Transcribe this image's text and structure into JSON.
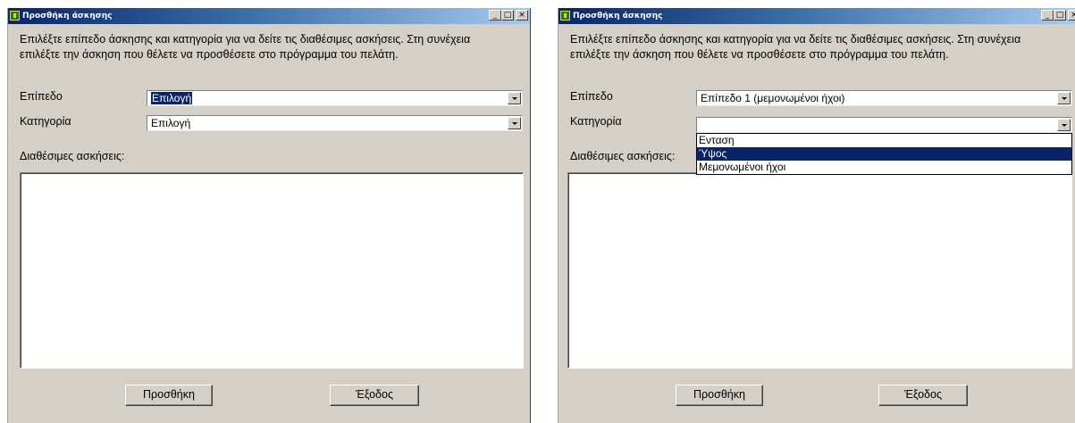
{
  "windows": [
    {
      "title": "Προσθήκη άσκησης",
      "titlebar_buttons": {
        "minimize": "_",
        "maximize": "□",
        "close": "×"
      },
      "instructions": "Επιλέξτε επίπεδο άσκησης και κατηγορία για να δείτε τις διαθέσιμες ασκήσεις. Στη συνέχεια\nεπιλέξτε την άσκηση που θέλετε να προσθέσετε στο πρόγραμμα του πελάτη.",
      "level_label": "Επίπεδο",
      "level_value": "Επιλογή",
      "category_label": "Κατηγορία",
      "category_value": "Επιλογή",
      "available_label": "Διαθέσιμες ασκήσεις:",
      "add_button": "Προσθήκη",
      "exit_button": "Έξοδος"
    },
    {
      "title": "Προσθήκη άσκησης",
      "titlebar_buttons": {
        "minimize": "_",
        "maximize": "□",
        "close": "×"
      },
      "instructions": "Επιλέξτε επίπεδο άσκησης και κατηγορία για να δείτε τις διαθέσιμες ασκήσεις. Στη συνέχεια\nεπιλέξτε την άσκηση που θέλετε να προσθέσετε στο πρόγραμμα του πελάτη.",
      "level_label": "Επίπεδο",
      "level_value": "Επίπεδο 1 (μεμονωμένοι ήχοι)",
      "category_label": "Κατηγορία",
      "category_value": "",
      "category_options": [
        "Ενταση",
        "Ύψος",
        "Μεμονωμένοι ήχοι"
      ],
      "category_highlighted_index": 1,
      "available_label": "Διαθέσιμες ασκήσεις:",
      "add_button": "Προσθήκη",
      "exit_button": "Έξοδος"
    }
  ],
  "colors": {
    "window_bg": "#d4d0c8",
    "titlebar_start": "#0a246a",
    "titlebar_end": "#a6caf0",
    "selection": "#0a246a"
  },
  "icons": [
    "app-icon",
    "minimize-icon",
    "maximize-icon",
    "close-icon",
    "dropdown-arrow-icon"
  ]
}
